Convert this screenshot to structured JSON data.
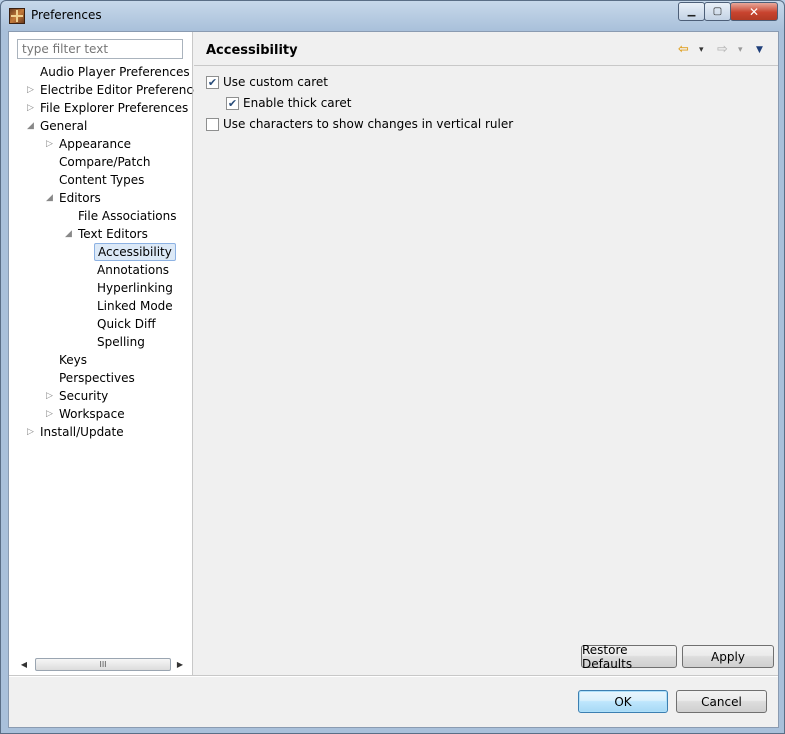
{
  "window": {
    "title": "Preferences"
  },
  "filter": {
    "placeholder": "type filter text"
  },
  "tree": [
    {
      "label": "Audio Player Preferences",
      "arrow": "",
      "depth": 0
    },
    {
      "label": "Electribe Editor Preferences",
      "arrow": "▷",
      "depth": 0
    },
    {
      "label": "File Explorer Preferences",
      "arrow": "▷",
      "depth": 0
    },
    {
      "label": "General",
      "arrow": "◢",
      "depth": 0
    },
    {
      "label": "Appearance",
      "arrow": "▷",
      "depth": 1
    },
    {
      "label": "Compare/Patch",
      "arrow": "",
      "depth": 1
    },
    {
      "label": "Content Types",
      "arrow": "",
      "depth": 1
    },
    {
      "label": "Editors",
      "arrow": "◢",
      "depth": 1
    },
    {
      "label": "File Associations",
      "arrow": "",
      "depth": 2
    },
    {
      "label": "Text Editors",
      "arrow": "◢",
      "depth": 2
    },
    {
      "label": "Accessibility",
      "arrow": "",
      "depth": 3,
      "selected": true
    },
    {
      "label": "Annotations",
      "arrow": "",
      "depth": 3
    },
    {
      "label": "Hyperlinking",
      "arrow": "",
      "depth": 3
    },
    {
      "label": "Linked Mode",
      "arrow": "",
      "depth": 3
    },
    {
      "label": "Quick Diff",
      "arrow": "",
      "depth": 3
    },
    {
      "label": "Spelling",
      "arrow": "",
      "depth": 3
    },
    {
      "label": "Keys",
      "arrow": "",
      "depth": 1
    },
    {
      "label": "Perspectives",
      "arrow": "",
      "depth": 1
    },
    {
      "label": "Security",
      "arrow": "▷",
      "depth": 1
    },
    {
      "label": "Workspace",
      "arrow": "▷",
      "depth": 1
    },
    {
      "label": "Install/Update",
      "arrow": "▷",
      "depth": 0
    }
  ],
  "scrollbar": {
    "left_arrow": "◀",
    "right_arrow": "▶",
    "grip": "III"
  },
  "page": {
    "title": "Accessibility",
    "back_icon": "⇦",
    "forward_icon": "⇨",
    "dropdown_icon": "▾",
    "menu_icon": "▼"
  },
  "options": [
    {
      "label": "Use custom caret",
      "checked": true
    },
    {
      "label": "Enable thick caret",
      "checked": true
    },
    {
      "label": "Use characters to show changes in vertical ruler",
      "checked": false
    }
  ],
  "buttons": {
    "restore_defaults": "Restore Defaults",
    "apply": "Apply",
    "ok": "OK",
    "cancel": "Cancel"
  },
  "window_controls": {
    "minimize": "▁",
    "maximize": "▢",
    "close": "✕"
  },
  "colors": {
    "selection_bg": "#dce9f7",
    "selection_border": "#8db2e3",
    "back_arrow": "#e0a020"
  }
}
